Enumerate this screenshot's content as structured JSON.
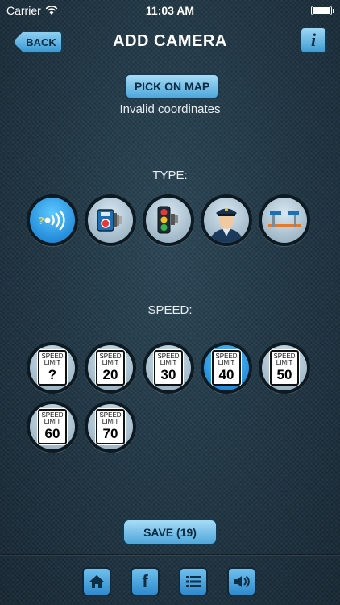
{
  "status_bar": {
    "carrier": "Carrier",
    "time": "11:03 AM"
  },
  "nav": {
    "back_label": "BACK",
    "title": "ADD CAMERA",
    "info_label": "i"
  },
  "location": {
    "pick_label": "PICK ON MAP",
    "status_text": "Invalid coordinates"
  },
  "type_section": {
    "label": "TYPE:",
    "items": [
      {
        "name": "unknown-camera",
        "icon": "question-signal-icon",
        "selected": true
      },
      {
        "name": "speed-camera",
        "icon": "speed-camera-icon",
        "selected": false
      },
      {
        "name": "red-light-camera",
        "icon": "traffic-light-camera-icon",
        "selected": false
      },
      {
        "name": "police",
        "icon": "police-officer-icon",
        "selected": false
      },
      {
        "name": "average-speed-camera",
        "icon": "average-speed-cameras-icon",
        "selected": false
      }
    ]
  },
  "speed_section": {
    "label": "SPEED:",
    "sign_text": "SPEED LIMIT",
    "items": [
      {
        "value": "?",
        "selected": false
      },
      {
        "value": "20",
        "selected": false
      },
      {
        "value": "30",
        "selected": false
      },
      {
        "value": "40",
        "selected": true
      },
      {
        "value": "50",
        "selected": false
      },
      {
        "value": "60",
        "selected": false
      },
      {
        "value": "70",
        "selected": false
      }
    ]
  },
  "save": {
    "label": "SAVE (19)"
  },
  "toolbar": {
    "items": [
      {
        "name": "home",
        "icon": "home-icon"
      },
      {
        "name": "facebook",
        "icon": "facebook-icon",
        "glyph": "f"
      },
      {
        "name": "list",
        "icon": "list-icon"
      },
      {
        "name": "sound",
        "icon": "speaker-icon"
      }
    ]
  },
  "colors": {
    "accent": "#3a9ad4",
    "selected": "#1f86d6",
    "background": "#1f3442"
  }
}
